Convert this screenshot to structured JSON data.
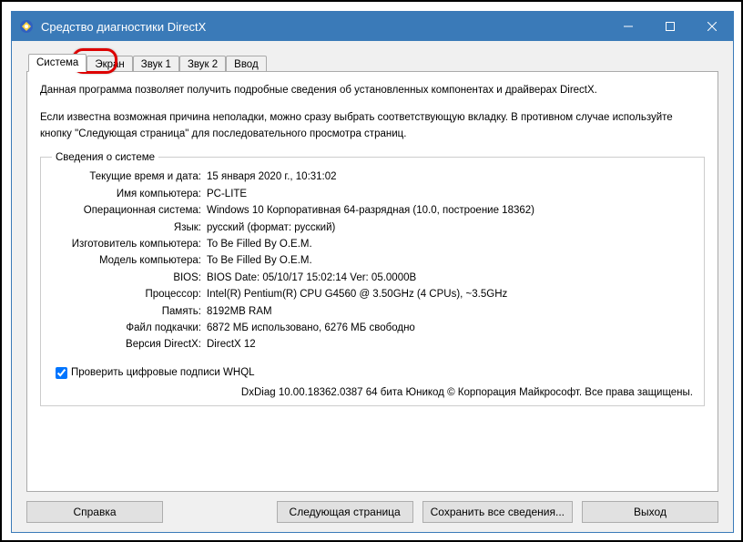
{
  "titlebar": {
    "title": "Средство диагностики DirectX"
  },
  "tabs": {
    "system": "Система",
    "display": "Экран",
    "sound1": "Звук 1",
    "sound2": "Звук 2",
    "input": "Ввод"
  },
  "intro": {
    "p1": "Данная программа позволяет получить подробные сведения об установленных компонентах и драйверах DirectX.",
    "p2": "Если известна возможная причина неполадки, можно сразу выбрать соответствующую вкладку. В противном случае используйте кнопку \"Следующая страница\" для последовательного просмотра страниц."
  },
  "system_info": {
    "legend": "Сведения о системе",
    "rows": [
      {
        "label": "Текущие время и дата:",
        "value": "15 января 2020 г., 10:31:02"
      },
      {
        "label": "Имя компьютера:",
        "value": "PC-LITE"
      },
      {
        "label": "Операционная система:",
        "value": "Windows 10 Корпоративная 64-разрядная (10.0, построение 18362)"
      },
      {
        "label": "Язык:",
        "value": "русский (формат: русский)"
      },
      {
        "label": "Изготовитель компьютера:",
        "value": "To Be Filled By O.E.M."
      },
      {
        "label": "Модель компьютера:",
        "value": "To Be Filled By O.E.M."
      },
      {
        "label": "BIOS:",
        "value": "BIOS Date: 05/10/17 15:02:14 Ver: 05.0000B"
      },
      {
        "label": "Процессор:",
        "value": "Intel(R) Pentium(R) CPU G4560 @ 3.50GHz (4 CPUs), ~3.5GHz"
      },
      {
        "label": "Память:",
        "value": "8192MB RAM"
      },
      {
        "label": "Файл подкачки:",
        "value": "6872 МБ использовано, 6276 МБ свободно"
      },
      {
        "label": "Версия DirectX:",
        "value": "DirectX 12"
      }
    ],
    "whql_check": "Проверить цифровые подписи WHQL",
    "footer": "DxDiag 10.00.18362.0387 64 бита Юникод © Корпорация Майкрософт. Все права защищены."
  },
  "buttons": {
    "help": "Справка",
    "next": "Следующая страница",
    "save": "Сохранить все сведения...",
    "exit": "Выход"
  }
}
